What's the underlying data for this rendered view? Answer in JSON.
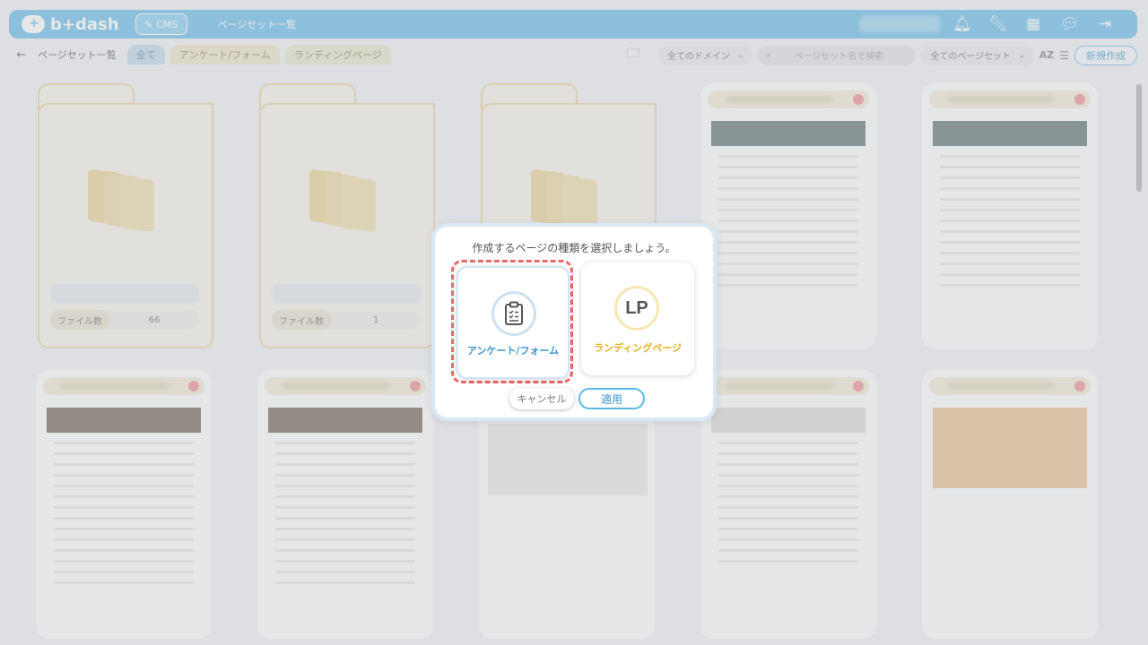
{
  "header": {
    "logo_text": "b+dash",
    "cms_label": "CMS",
    "title": "ページセット一覧",
    "icons": [
      "bell-icon",
      "wrench-icon",
      "grid-icon",
      "chat-icon",
      "logout-icon"
    ]
  },
  "toolbar": {
    "back_icon": "arrow-left-icon",
    "breadcrumb": "ページセット一覧",
    "tabs": [
      {
        "label": "全て",
        "active": true
      },
      {
        "label": "アンケート/フォーム"
      },
      {
        "label": "ランディングページ"
      }
    ],
    "domain_select": "全てのドメイン",
    "search_placeholder": "ページセット名で検索",
    "pageset_select": "全てのページセット",
    "sort_label": "AZ",
    "new_button": "新規作成"
  },
  "folders": [
    {
      "count_label": "ファイル数",
      "count": "66"
    },
    {
      "count_label": "ファイル数",
      "count": "1"
    }
  ],
  "modal": {
    "title": "作成するページの種類を選択しましょう。",
    "options": [
      {
        "label": "アンケート/フォーム",
        "icon": "clipboard-icon",
        "selected": true
      },
      {
        "label": "ランディングページ",
        "icon_text": "LP",
        "selected": false
      }
    ],
    "cancel_label": "キャンセル",
    "apply_label": "適用"
  }
}
